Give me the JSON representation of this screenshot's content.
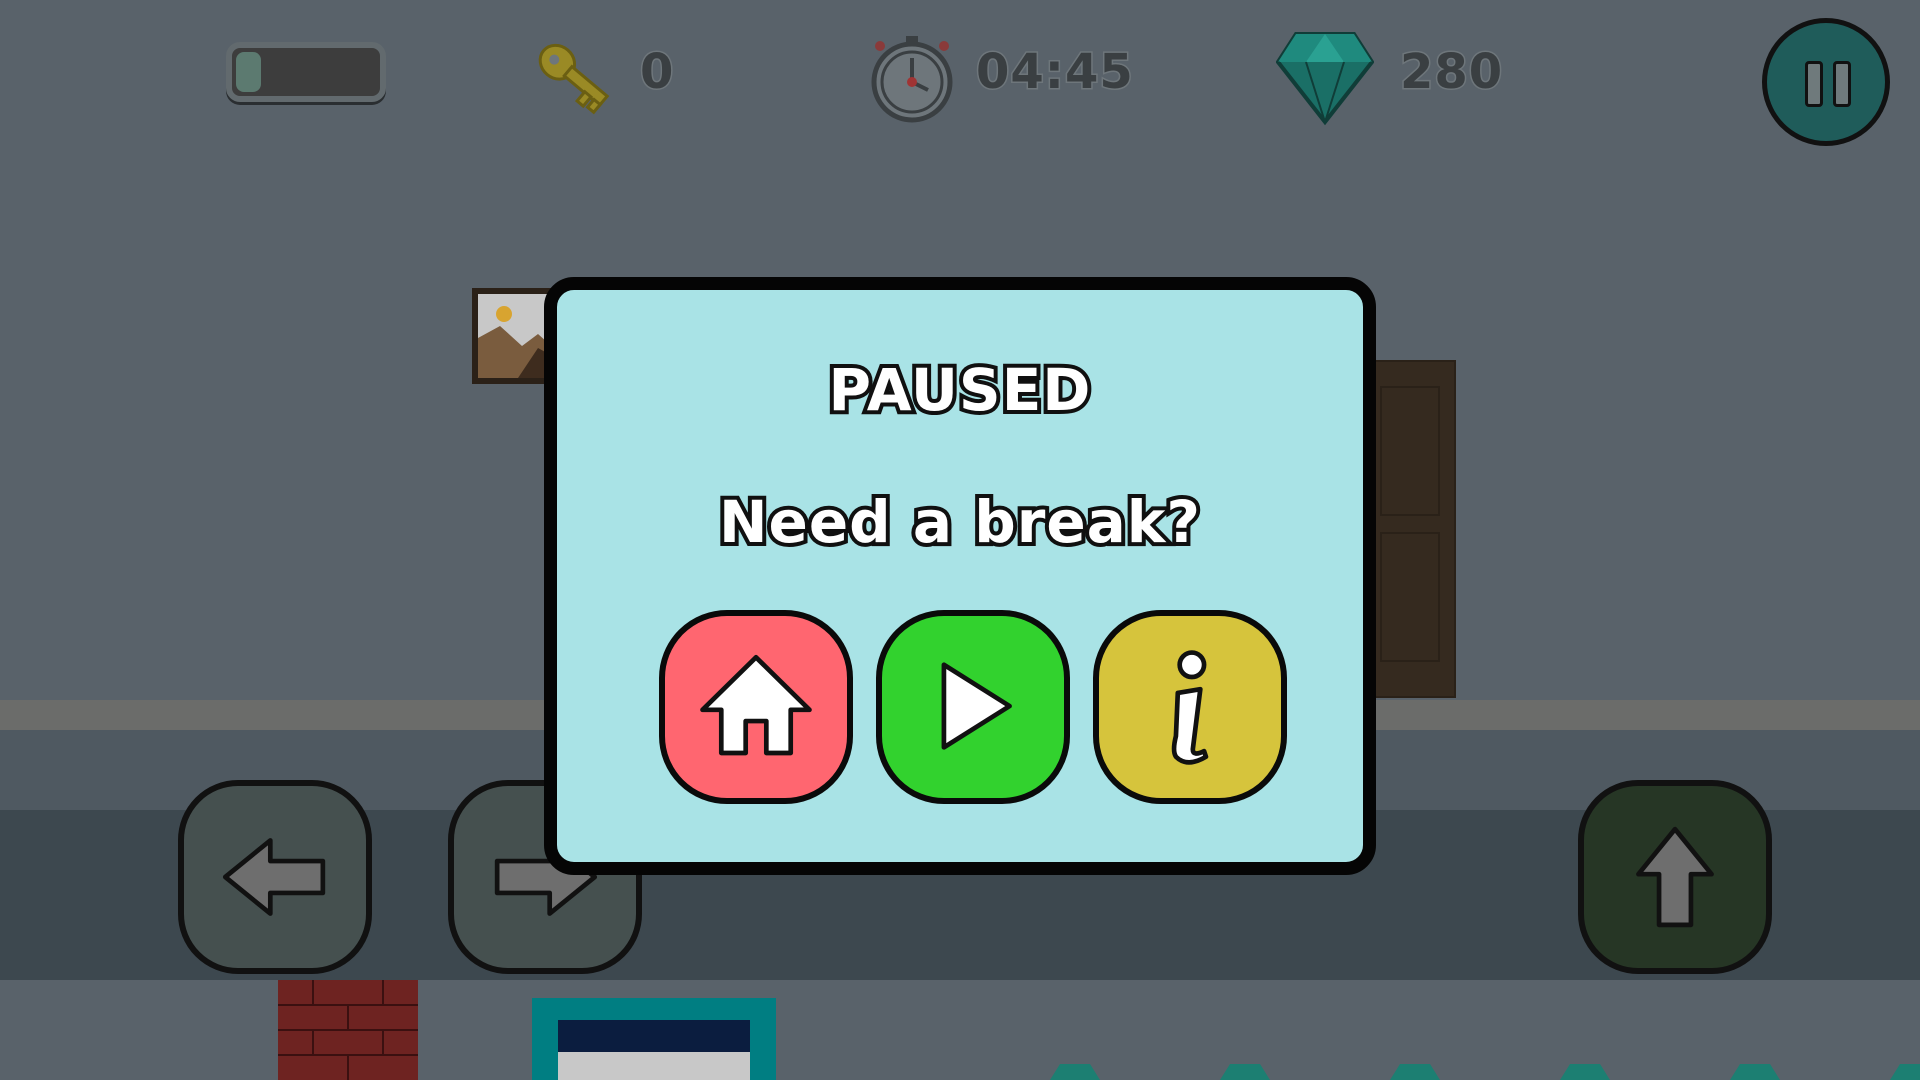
{
  "hud": {
    "stamina_level": 0.18,
    "keys_count": "0",
    "timer": "04:45",
    "gems_count": "280",
    "icons": {
      "stamina": "stamina-bar",
      "key": "key-icon",
      "timer": "stopwatch-icon",
      "gem": "diamond-icon",
      "pause": "pause-icon"
    }
  },
  "pause_dialog": {
    "title": "PAUSED",
    "subtitle": "Need a break?",
    "buttons": [
      {
        "name": "home",
        "icon": "home-icon",
        "color": "#ff6670"
      },
      {
        "name": "resume",
        "icon": "play-icon",
        "color": "#32d22e"
      },
      {
        "name": "info",
        "icon": "info-icon",
        "color": "#d6c43c"
      }
    ]
  },
  "controls": {
    "left": "arrow-left-icon",
    "right": "arrow-right-icon",
    "jump": "arrow-up-icon"
  },
  "colors": {
    "dialog_bg": "#a9e3e6",
    "pause_button": "#1f5c5a",
    "gem": "#1a8a7c",
    "key": "#9a8a25"
  }
}
